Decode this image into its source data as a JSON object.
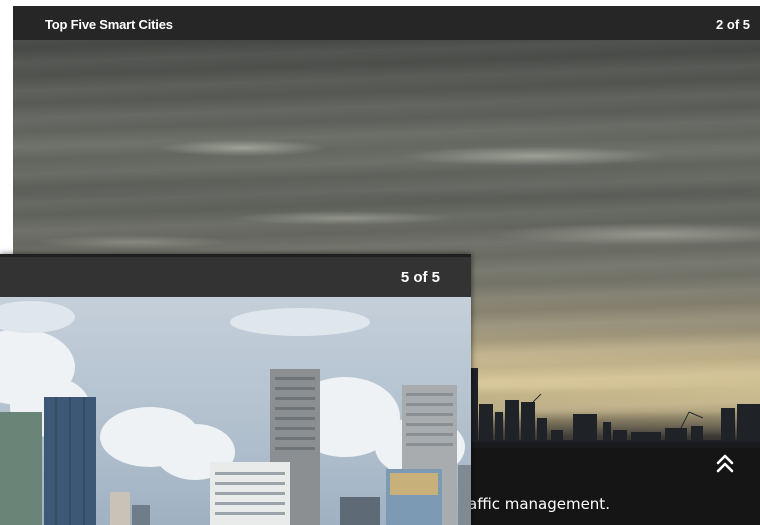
{
  "back_slide": {
    "title": "Top Five Smart Cities",
    "counter": "2 of 5",
    "caption": "affic management.",
    "expand_icon": "double-chevron-up-icon"
  },
  "front_slide": {
    "counter": "5 of 5"
  }
}
